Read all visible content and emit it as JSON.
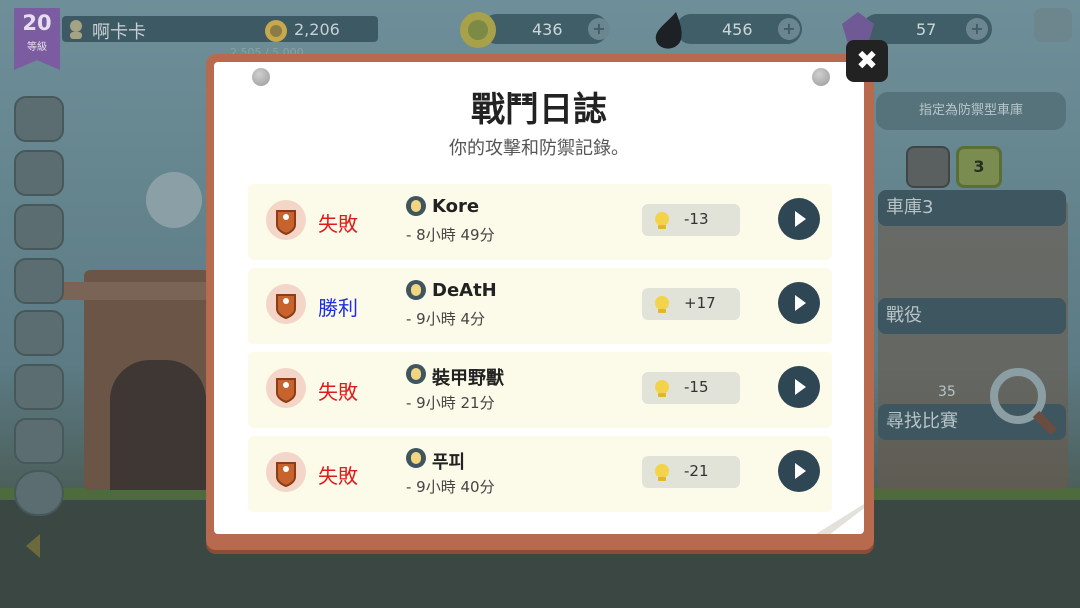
{
  "hud": {
    "level": "20",
    "level_label": "等級",
    "player_name": "啊卡卡",
    "trophies": "2,206",
    "xp": "2,505 / 5,000",
    "coins": "436",
    "oil": "456",
    "gems": "57"
  },
  "right_panel": {
    "garage_tip": "指定為防禦型車庫",
    "garage_number": "3",
    "garage_label": "車庫3",
    "campaign_label": "戰役",
    "find_match_label": "尋找比賽",
    "find_match_count": "35"
  },
  "modal": {
    "title": "戰鬥日誌",
    "subtitle": "你的攻擊和防禦記錄。",
    "close_symbol": "✖",
    "entries": [
      {
        "result": "失敗",
        "result_type": "lose",
        "opponent": "Kore",
        "time": "- 8小時 49分",
        "trophy_delta": "-13"
      },
      {
        "result": "勝利",
        "result_type": "win",
        "opponent": "DeAtH",
        "time": "- 9小時 4分",
        "trophy_delta": "+17"
      },
      {
        "result": "失敗",
        "result_type": "lose",
        "opponent": "裝甲野獸",
        "time": "- 9小時 21分",
        "trophy_delta": "-15"
      },
      {
        "result": "失敗",
        "result_type": "lose",
        "opponent": "푸피",
        "time": "- 9小時 40分",
        "trophy_delta": "-21"
      }
    ]
  },
  "colors": {
    "lose": "#e01919",
    "win": "#1c2fe0",
    "frame": "#b86a4f",
    "row_bg": "#fcfbea"
  },
  "icons": {
    "shield": "shield-icon",
    "trophy": "trophy-icon",
    "play": "play-icon",
    "close": "close-icon",
    "avatar": "avatar-icon"
  }
}
